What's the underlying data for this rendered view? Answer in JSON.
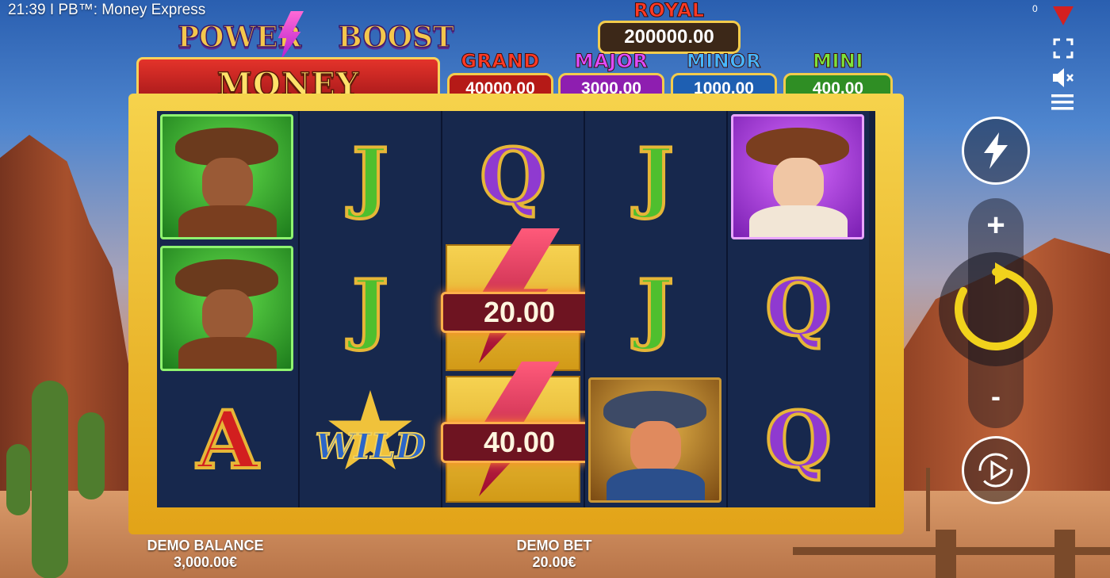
{
  "status_bar": {
    "text": "21:39 I PB™: Money Express"
  },
  "logo": {
    "line1": "POWER",
    "line1b": "BOOST",
    "line2": "MONEY EXPRESS"
  },
  "jackpots": {
    "royal": {
      "label": "ROYAL",
      "value": "200000.00"
    },
    "grand": {
      "label": "GRAND",
      "value": "40000.00",
      "color": "#e0231f"
    },
    "major": {
      "label": "MAJOR",
      "value": "3000.00",
      "color": "#b42ac9"
    },
    "minor": {
      "label": "MINOR",
      "value": "1000.00",
      "color": "#2a7ad0"
    },
    "mini": {
      "label": "MINI",
      "value": "400.00",
      "color": "#3da82a"
    }
  },
  "reels": [
    [
      "outlaw",
      "outlaw",
      "A"
    ],
    [
      "J",
      "J",
      "WILD"
    ],
    [
      "Q",
      "bolt",
      "bolt"
    ],
    [
      "J",
      "J",
      "sheriff"
    ],
    [
      "cowgirl",
      "Q",
      "Q"
    ]
  ],
  "bolt_values": [
    "20.00",
    "40.00"
  ],
  "top_right": {
    "counter": "0"
  },
  "controls": {
    "plus": "+",
    "minus": "-"
  },
  "footer": {
    "balance_label": "DEMO BALANCE",
    "balance_value": "3,000.00€",
    "bet_label": "DEMO BET",
    "bet_value": "20.00€"
  }
}
